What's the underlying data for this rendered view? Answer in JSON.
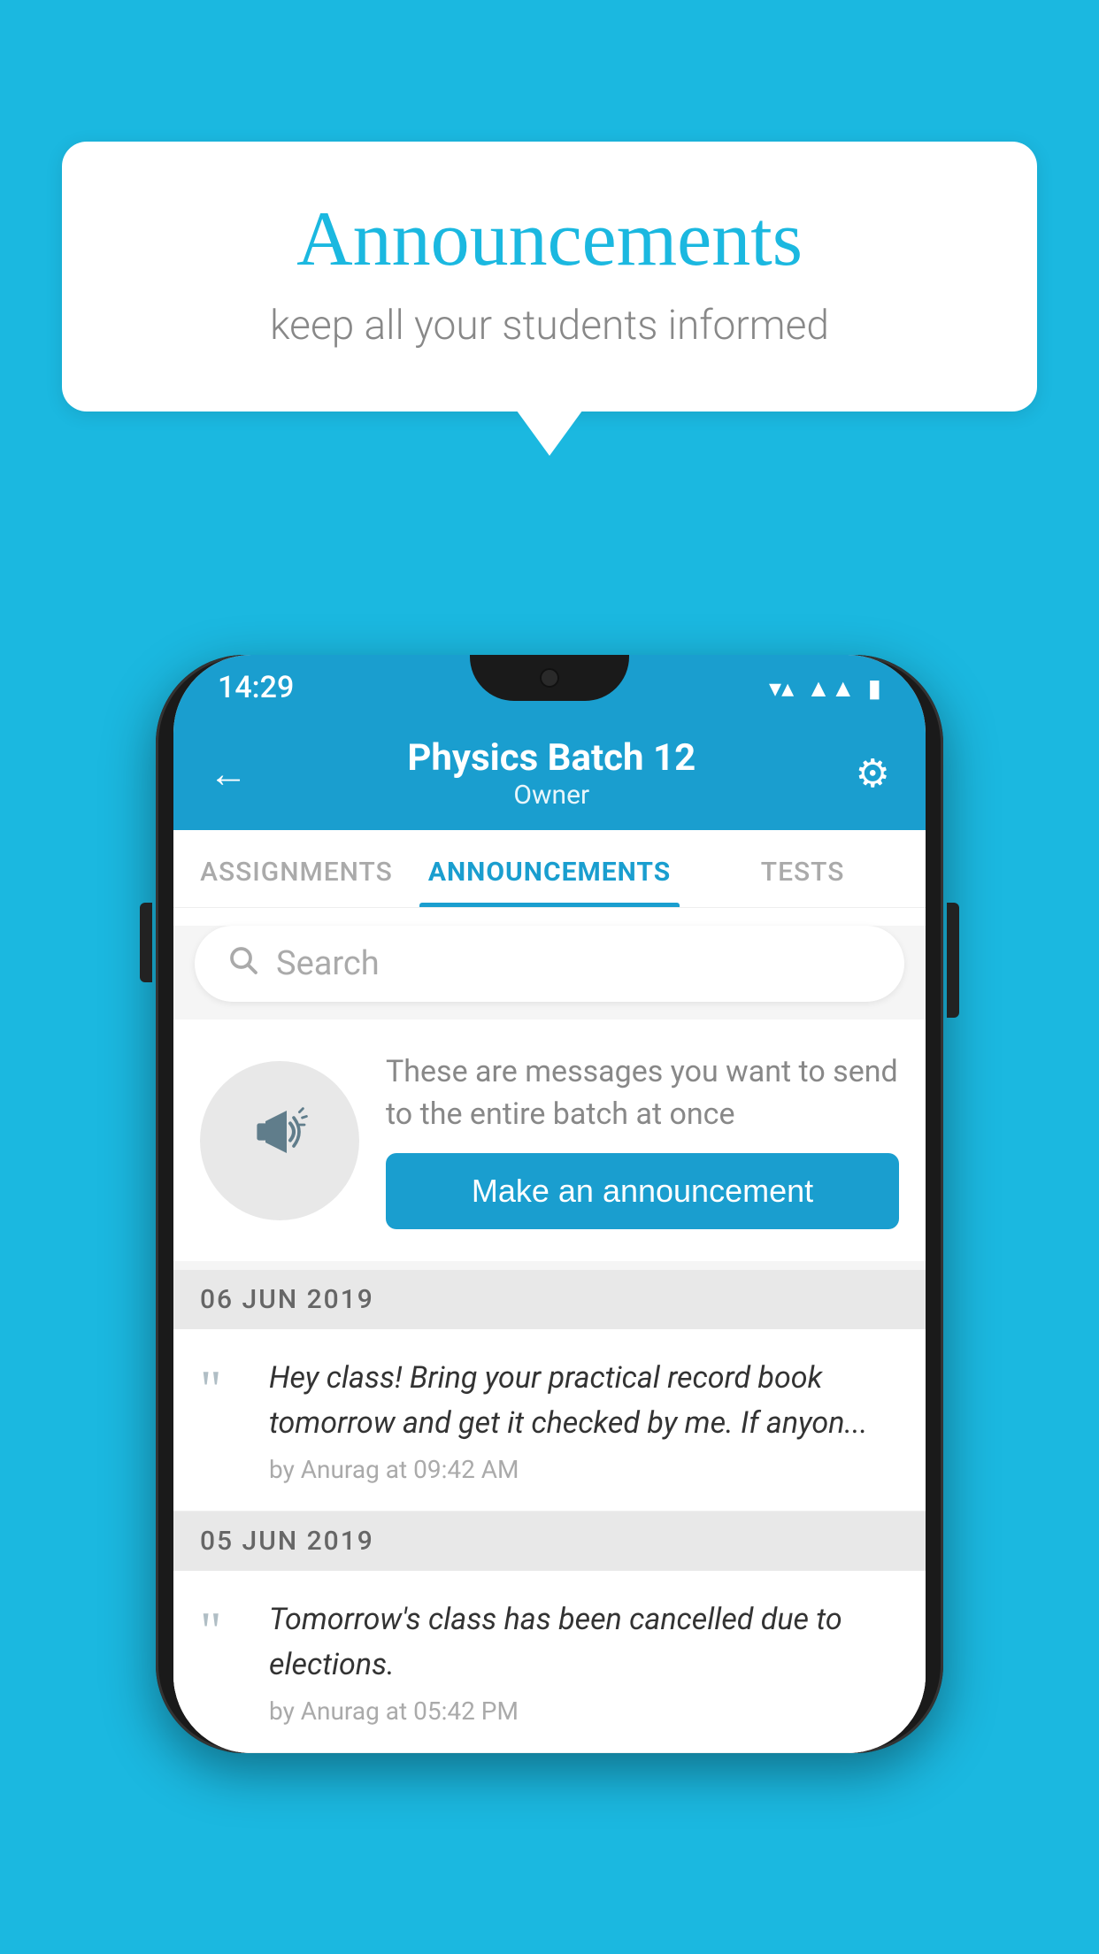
{
  "background_color": "#1BB8E0",
  "speech_bubble": {
    "title": "Announcements",
    "subtitle": "keep all your students informed"
  },
  "phone": {
    "status_bar": {
      "time": "14:29",
      "icons": [
        "wifi",
        "signal",
        "battery"
      ]
    },
    "header": {
      "back_label": "←",
      "title": "Physics Batch 12",
      "subtitle": "Owner",
      "gear_label": "⚙"
    },
    "tabs": [
      {
        "label": "ASSIGNMENTS",
        "active": false
      },
      {
        "label": "ANNOUNCEMENTS",
        "active": true
      },
      {
        "label": "TESTS",
        "active": false
      }
    ],
    "search": {
      "placeholder": "Search"
    },
    "cta_card": {
      "description": "These are messages you want to send to the entire batch at once",
      "button_label": "Make an announcement"
    },
    "announcements": [
      {
        "date": "06  JUN  2019",
        "items": [
          {
            "text": "Hey class! Bring your practical record book tomorrow and get it checked by me. If anyon...",
            "meta": "by Anurag at 09:42 AM"
          }
        ]
      },
      {
        "date": "05  JUN  2019",
        "items": [
          {
            "text": "Tomorrow's class has been cancelled due to elections.",
            "meta": "by Anurag at 05:42 PM"
          }
        ]
      }
    ]
  }
}
